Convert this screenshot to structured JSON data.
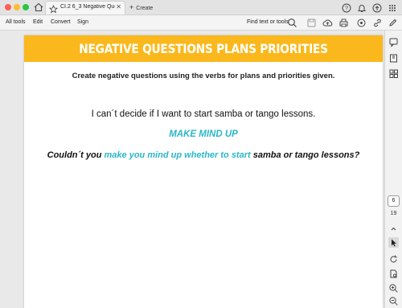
{
  "window": {
    "tab_title": "CI.2 6_3 Negative Que...",
    "tab_close": "✕",
    "new_tab_label": "Create"
  },
  "menubar": {
    "items": [
      "All tools",
      "Edit",
      "Convert",
      "Sign"
    ],
    "find_text": "Find text or tools"
  },
  "sidebar": {
    "current_page": "6",
    "total_pages": "19"
  },
  "document": {
    "banner_title": "NEGATIVE QUESTIONS PLANS PRIORITIES",
    "instruction": "Create negative questions using the verbs for plans and priorities given.",
    "prompt": "I can´t decide if I want to start samba or tango lessons.",
    "verb": "MAKE MIND UP",
    "answer_prefix": "Couldn´t you",
    "answer_highlight": "make you mind up whether to start",
    "answer_suffix": "samba or tango lessons?"
  },
  "colors": {
    "banner": "#fbb81c",
    "accent": "#2bb6c8"
  }
}
